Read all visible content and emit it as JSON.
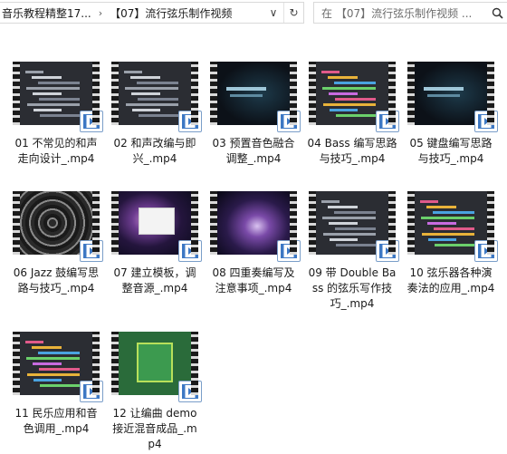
{
  "address_bar": {
    "crumbs": [
      "音乐教程精整17...",
      "【07】流行弦乐制作视频"
    ],
    "separator": "›",
    "dropdown_glyph": "∨",
    "refresh_glyph": "↻"
  },
  "search": {
    "placeholder": "在 【07】流行弦乐制作视频 ..."
  },
  "items": [
    {
      "label": "01 不常见的和声走向设计_.mp4",
      "thumb": "daw-score"
    },
    {
      "label": "02 和声改编与即兴_.mp4",
      "thumb": "daw"
    },
    {
      "label": "03 预置音色融合调整_.mp4",
      "thumb": "dark-title"
    },
    {
      "label": "04 Bass 编写思路与技巧_.mp4",
      "thumb": "daw-color"
    },
    {
      "label": "05 键盘编写思路与技巧_.mp4",
      "thumb": "dark-title-2"
    },
    {
      "label": "06 Jazz 鼓编写思路与技巧_.mp4",
      "thumb": "tunnel"
    },
    {
      "label": "07 建立模板，调整音源_.mp4",
      "thumb": "space-dialog"
    },
    {
      "label": "08 四重奏编写及注意事项_.mp4",
      "thumb": "space"
    },
    {
      "label": "09 带 Double Bass 的弦乐写作技巧_.mp4",
      "thumb": "daw"
    },
    {
      "label": "10 弦乐器各种演奏法的应用_.mp4",
      "thumb": "daw-color"
    },
    {
      "label": "11 民乐应用和音色调用_.mp4",
      "thumb": "daw-multi"
    },
    {
      "label": "12 让编曲 demo 接近混音成品_.mp4",
      "thumb": "slide"
    }
  ],
  "colors": {
    "badge_border": "#7a9ec9",
    "badge_icon": "#3d78c4"
  }
}
